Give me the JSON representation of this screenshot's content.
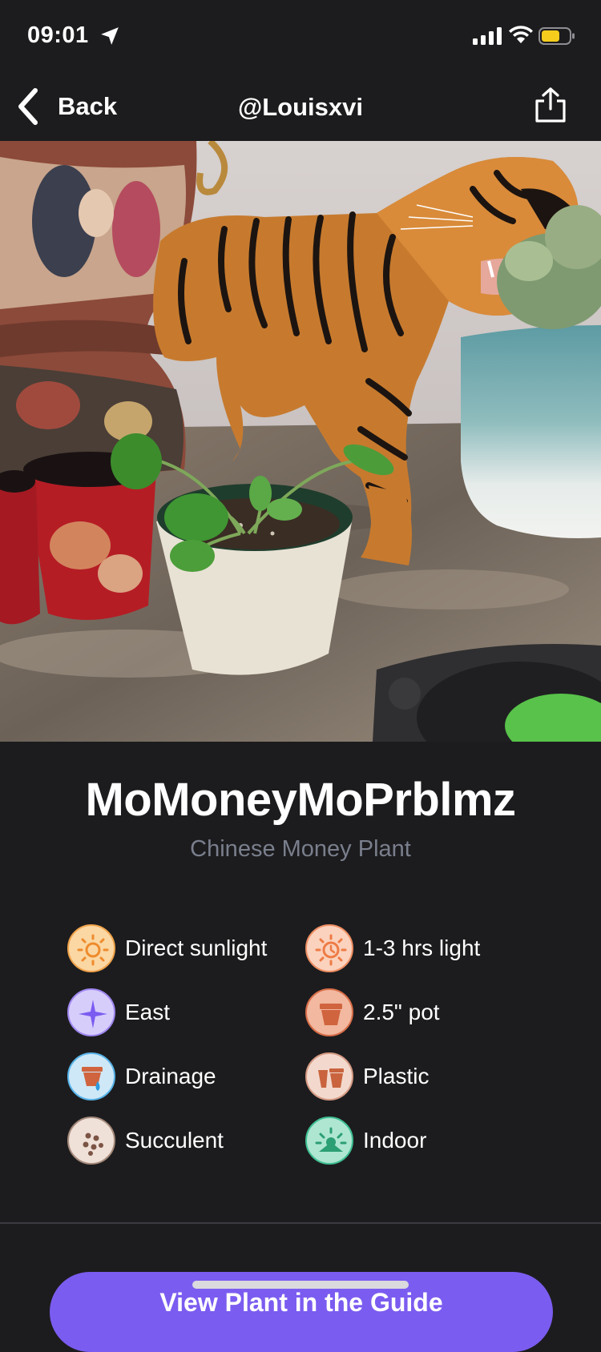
{
  "status_bar": {
    "time": "09:01",
    "battery_color": "#f6cd1c"
  },
  "nav": {
    "back_label": "Back",
    "title": "@Louisxvi",
    "share_icon": "share-icon"
  },
  "plant": {
    "name": "MoMoneyMoPrblmz",
    "species": "Chinese Money Plant"
  },
  "attributes": [
    {
      "label": "Direct sunlight",
      "icon": "sun-icon",
      "color": "#fbd7a3"
    },
    {
      "label": "1-3 hrs light",
      "icon": "sun-clock-icon",
      "color": "#fbd2bd"
    },
    {
      "label": "East",
      "icon": "compass-star-icon",
      "color": "#d7cdfb"
    },
    {
      "label": "2.5\" pot",
      "icon": "pot-icon",
      "color": "#f2b8a0"
    },
    {
      "label": "Drainage",
      "icon": "drainage-pot-icon",
      "color": "#cfe8f7"
    },
    {
      "label": "Plastic",
      "icon": "pot-material-icon",
      "color": "#f3d9cd"
    },
    {
      "label": "Succulent",
      "icon": "soil-icon",
      "color": "#efe0d8"
    },
    {
      "label": "Indoor",
      "icon": "indoor-icon",
      "color": "#aee6d2"
    }
  ],
  "cta": {
    "label": "View Plant in the Guide"
  },
  "colors": {
    "background": "#1c1c1e",
    "accent": "#7b5cf0",
    "species_text": "#7a7f8d"
  }
}
